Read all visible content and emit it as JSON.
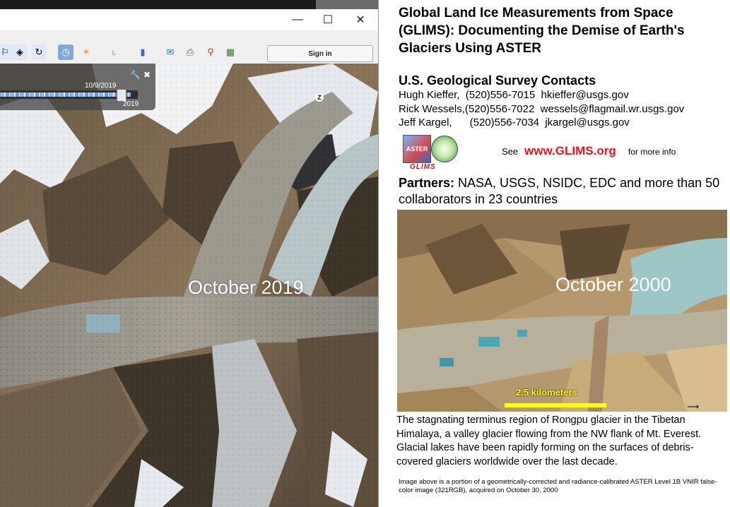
{
  "earth_window": {
    "toolbar": {
      "signin_label": "Sign in"
    },
    "time_slider": {
      "current_date": "10/9/2019",
      "end_year": "2019"
    },
    "map_label": "October 2019",
    "colors": {
      "slider_bg": "#464646",
      "signin_bg": "#f7f7f7"
    }
  },
  "document": {
    "title": "Global Land Ice Measurements from Space (GLIMS):  Documenting the Demise of Earth's Glaciers Using ASTER",
    "contacts_heading": "U.S. Geological Survey Contacts",
    "contacts": [
      "Hugh Kieffer,  (520)556-7015  hkieffer@usgs.gov",
      "Rick Wessels,(520)556-7022  wessels@flagmail.wr.usgs.gov",
      "Jeff Kargel,      (520)556-7034  jkargel@usgs.gov"
    ],
    "logo_aster_text": "ASTER",
    "logo_glims_text": "GLIMS",
    "see_text": "See",
    "url": "www.GLIMS.org",
    "more_info": "for more info",
    "partners_label": "Partners:",
    "partners_text": " NASA, USGS, NSIDC, EDC and more than 50 collaborators in 23 countries",
    "image_label": "October 2000",
    "scale_label": "2.5 kilometers",
    "caption": "The stagnating terminus region of Rongpu glacier in the Tibetan Himalaya, a valley glacier flowing from the NW flank of Mt. Everest.  Glacial lakes have been rapidly forming on the surfaces of debris-covered glaciers worldwide over the last decade.",
    "footnote": "Image above is a portion of a geometrically-corrected and radiance-calibrated ASTER Level 1B VNIR false-color image (321RGB), acquired on October 30, 2000",
    "colors": {
      "url": "#e4151f",
      "scale_bar": "#ffff00"
    }
  }
}
